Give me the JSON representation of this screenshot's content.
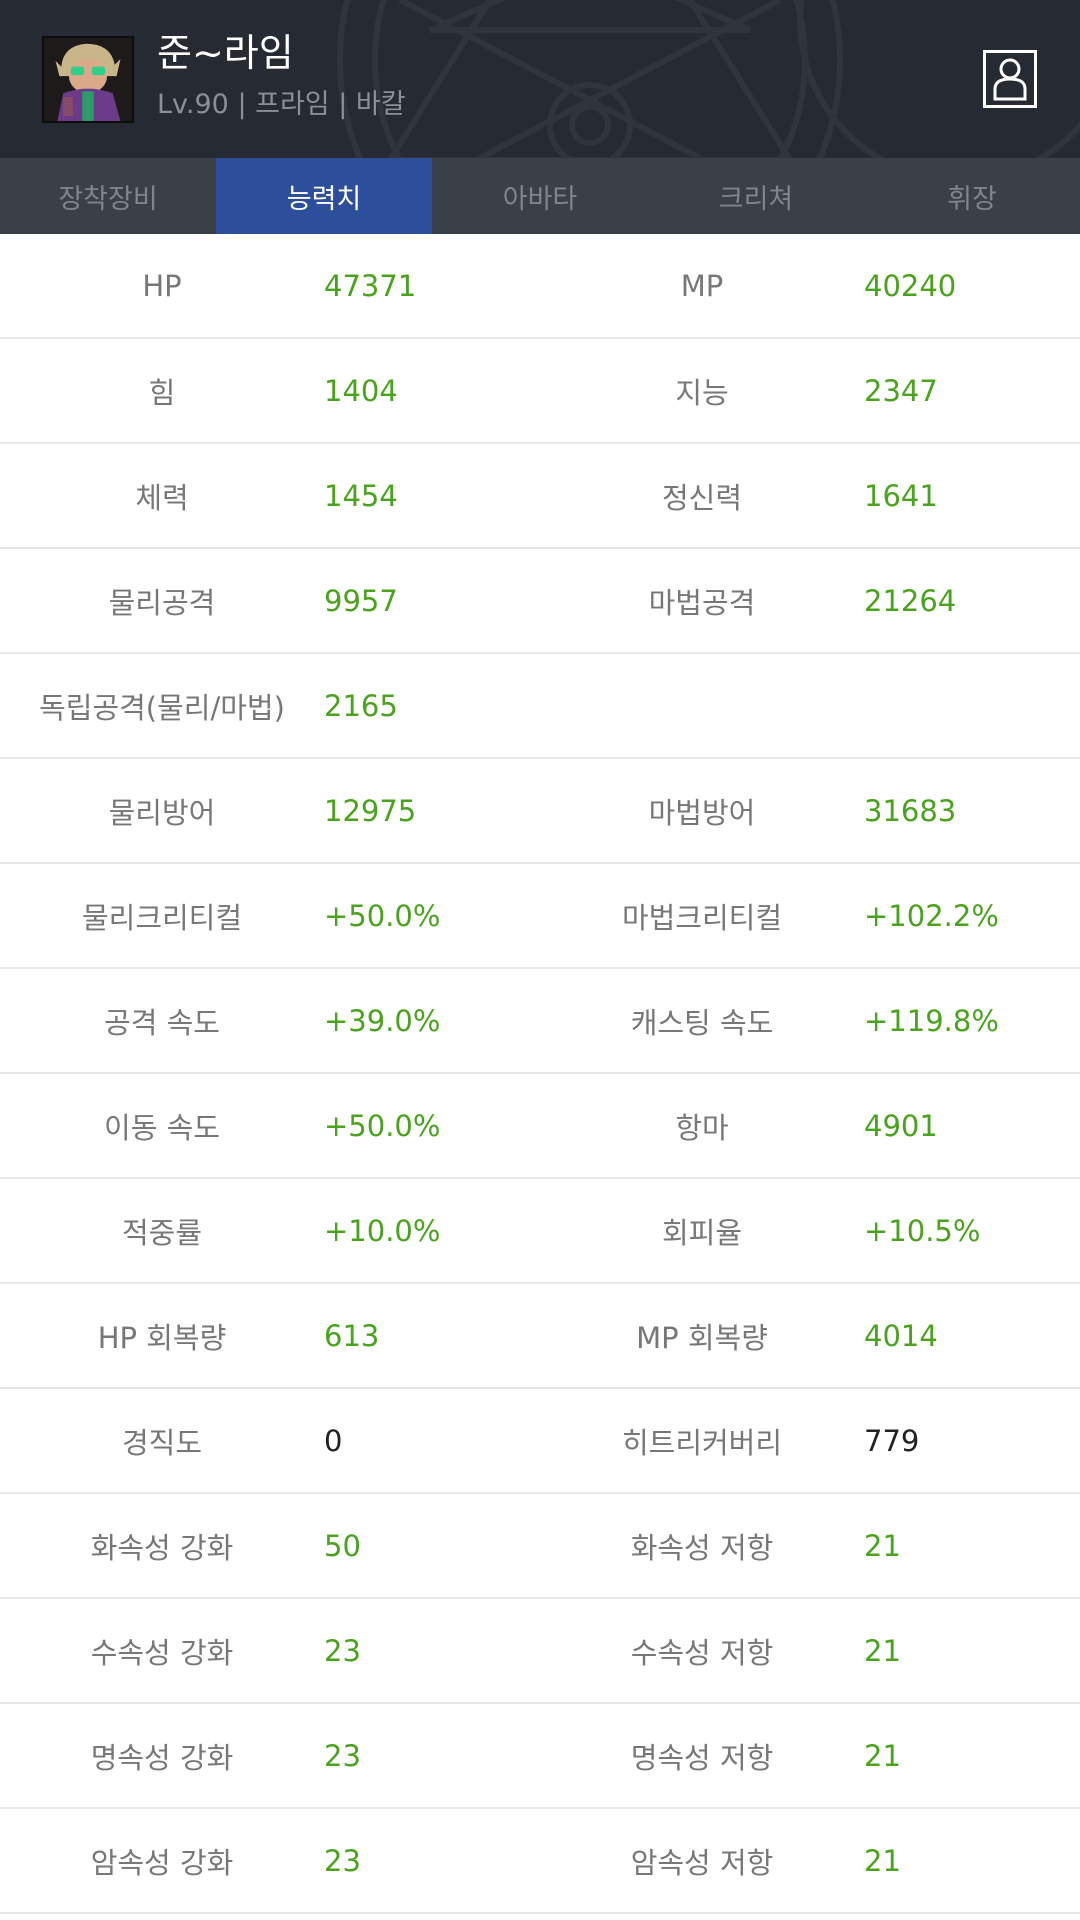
{
  "header": {
    "name": "준~라임",
    "meta": "Lv.90 | 프라임 | 바칼"
  },
  "tabs": [
    {
      "label": "장착장비",
      "active": false
    },
    {
      "label": "능력치",
      "active": true
    },
    {
      "label": "아바타",
      "active": false
    },
    {
      "label": "크리쳐",
      "active": false
    },
    {
      "label": "휘장",
      "active": false
    }
  ],
  "stats": [
    {
      "l_label": "HP",
      "l_value": "47371",
      "r_label": "MP",
      "r_value": "40240"
    },
    {
      "l_label": "힘",
      "l_value": "1404",
      "r_label": "지능",
      "r_value": "2347"
    },
    {
      "l_label": "체력",
      "l_value": "1454",
      "r_label": "정신력",
      "r_value": "1641"
    },
    {
      "l_label": "물리공격",
      "l_value": "9957",
      "r_label": "마법공격",
      "r_value": "21264"
    },
    {
      "l_label": "독립공격(물리/마법)",
      "l_value": "2165",
      "r_label": "",
      "r_value": ""
    },
    {
      "l_label": "물리방어",
      "l_value": "12975",
      "r_label": "마법방어",
      "r_value": "31683"
    },
    {
      "l_label": "물리크리티컬",
      "l_value": "+50.0%",
      "r_label": "마법크리티컬",
      "r_value": "+102.2%"
    },
    {
      "l_label": "공격 속도",
      "l_value": "+39.0%",
      "r_label": "캐스팅 속도",
      "r_value": "+119.8%"
    },
    {
      "l_label": "이동 속도",
      "l_value": "+50.0%",
      "r_label": "항마",
      "r_value": "4901"
    },
    {
      "l_label": "적중률",
      "l_value": "+10.0%",
      "r_label": "회피율",
      "r_value": "+10.5%"
    },
    {
      "l_label": "HP 회복량",
      "l_value": "613",
      "r_label": "MP 회복량",
      "r_value": "4014"
    },
    {
      "l_label": "경직도",
      "l_value": "0",
      "r_label": "히트리커버리",
      "r_value": "779"
    },
    {
      "l_label": "화속성 강화",
      "l_value": "50",
      "r_label": "화속성 저항",
      "r_value": "21"
    },
    {
      "l_label": "수속성 강화",
      "l_value": "23",
      "r_label": "수속성 저항",
      "r_value": "21"
    },
    {
      "l_label": "명속성 강화",
      "l_value": "23",
      "r_label": "명속성 저항",
      "r_value": "21"
    },
    {
      "l_label": "암속성 강화",
      "l_value": "23",
      "r_label": "암속성 저항",
      "r_value": "21"
    }
  ],
  "colors": {
    "value_green": "#4aa31c",
    "value_plain": "#222222",
    "tab_active": "#2d4f9b",
    "header_bg": "#262a33"
  }
}
